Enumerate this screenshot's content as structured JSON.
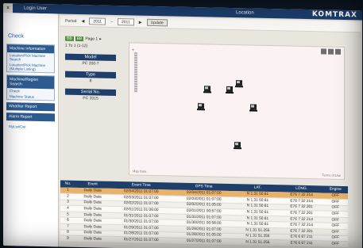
{
  "topbar": {
    "close_label": "x",
    "nav": [
      "Login User",
      "Location"
    ],
    "brand": "KOMTRAX"
  },
  "sidebar": {
    "title": "Check",
    "sections": [
      {
        "header": "Machine Information",
        "links": [
          "Location/Pick Machine Search",
          "Location/Pick Machine (Multiple Listing)"
        ]
      },
      {
        "header": "Machine/Region Search",
        "links": [
          "Check",
          "Machine Status"
        ]
      },
      {
        "header": "Weather Report",
        "links": []
      },
      {
        "header": "Alarm Report",
        "links": []
      }
    ],
    "footer_link": "MyList/Out"
  },
  "toolbar": {
    "period_label": "Period",
    "from_date": "2011",
    "to_date": "2011",
    "update_label": "Update"
  },
  "info": {
    "pager_chip_1": "BB",
    "pager_chip_2": "BB",
    "page_text": "Page 1",
    "records": "1 To 1 (1-12)",
    "model_label": "Model",
    "model_value": "PC 200-7",
    "type_label": "Type",
    "type_value": "8",
    "serial_label": "Serial No.",
    "serial_value": "PC 2015"
  },
  "map": {
    "footer_left": "Map Data",
    "footer_right": "Terms of Use"
  },
  "table": {
    "headers": [
      "No.",
      "Event",
      "Event Time",
      "GPS Time",
      "LAT.",
      "LONG.",
      "Engine"
    ],
    "rows": [
      [
        "1",
        "Daily Data",
        "02/04/2011 01:07:00",
        "02/04/2011 01:07:00",
        "N 1.31 50.61",
        "E76 7 32 214",
        "OFF"
      ],
      [
        "2",
        "Daily Data",
        "02/03/2011 01:07:00",
        "02/03/2011 01:07:00",
        "N 1.31 50.61",
        "E76 7 32 214",
        "OFF"
      ],
      [
        "3",
        "Daily Data",
        "02/02/2011 01:07:00",
        "02/02/2011 01:05:00",
        "N 1.31 50.61",
        "E76 7 32 201",
        "OFF"
      ],
      [
        "4",
        "Daily Data",
        "02/01/2011 01:06:00",
        "02/01/2011 00:57:00",
        "N 1.31 50.61",
        "E76 7 32 201",
        "OFF"
      ],
      [
        "5",
        "Daily Data",
        "01/31/2011 01:07:00",
        "01/31/2011 01:07:00",
        "N 1.31 50.61",
        "E76 7 32 214",
        "OFF"
      ],
      [
        "6",
        "Daily Data",
        "01/30/2011 01:07:00",
        "01/30/2011 00:58:00",
        "N 1.31 50.61",
        "E76 7 32 214",
        "OFF"
      ],
      [
        "7",
        "Daily Data",
        "01/29/2011 01:07:00",
        "01/29/2011 01:07:00",
        "N 1.31 51.255",
        "E76 7 32 201",
        "OFF"
      ],
      [
        "8",
        "Daily Data",
        "01/28/2011 01:07:00",
        "01/28/2011 01:05:00",
        "N 1.31 51.255",
        "E76 6 87 211",
        "OFF"
      ],
      [
        "9",
        "Daily Data",
        "01/27/2011 01:07:00",
        "01/27/2011 01:07:00",
        "N 1.31 51.255",
        "E76 6 87 211",
        "OFF"
      ]
    ],
    "selected_row": 0
  }
}
